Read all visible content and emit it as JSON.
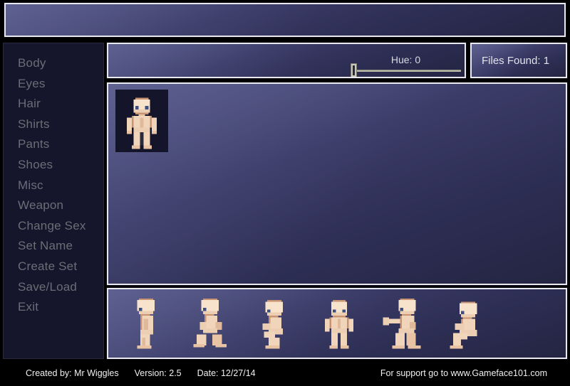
{
  "app": {
    "title_bar_text": "",
    "background_color": "#000000",
    "panel_gradient_from": "#5c5e8e",
    "panel_gradient_to": "#242442",
    "panel_border_color": "#e8e8ee",
    "sidebar_bg": "#15152c",
    "sidebar_text_color": "#6d6d76",
    "footer_text_color": "#f0f0f0",
    "skin_light": "#f7e2cb",
    "skin_mid": "#e8c3a4",
    "skin_shadow": "#c89372",
    "skin_outline": "#9c6a52",
    "eye_color": "#3c4e82",
    "tile_bg": "#14142a"
  },
  "sidebar": {
    "items": [
      {
        "label": "Body"
      },
      {
        "label": "Eyes"
      },
      {
        "label": "Hair"
      },
      {
        "label": "Shirts"
      },
      {
        "label": "Pants"
      },
      {
        "label": "Shoes"
      },
      {
        "label": "Misc"
      },
      {
        "label": "Weapon"
      },
      {
        "label": "Change Sex"
      },
      {
        "label": "Set Name"
      },
      {
        "label": "Create Set"
      },
      {
        "label": "Save/Load"
      },
      {
        "label": "Exit"
      }
    ]
  },
  "hue_bar": {
    "slider_label": "Hue: 0",
    "slider_value": 0,
    "slider_min": 0,
    "slider_max": 360,
    "handle_position_percent": 0
  },
  "files_box": {
    "label": "Files Found: 1",
    "count": 1
  },
  "preview": {
    "selected_sprite": "character-front-idle",
    "tile_count": 1
  },
  "animation_strip": {
    "frames": [
      {
        "name": "side-idle"
      },
      {
        "name": "walk"
      },
      {
        "name": "crouch"
      },
      {
        "name": "front-idle"
      },
      {
        "name": "punch"
      },
      {
        "name": "sit"
      }
    ]
  },
  "footer": {
    "created_by": "Created by: Mr Wiggles",
    "version": "Version: 2.5",
    "date": "Date: 12/27/14",
    "support": "For support go to www.Gameface101.com"
  }
}
